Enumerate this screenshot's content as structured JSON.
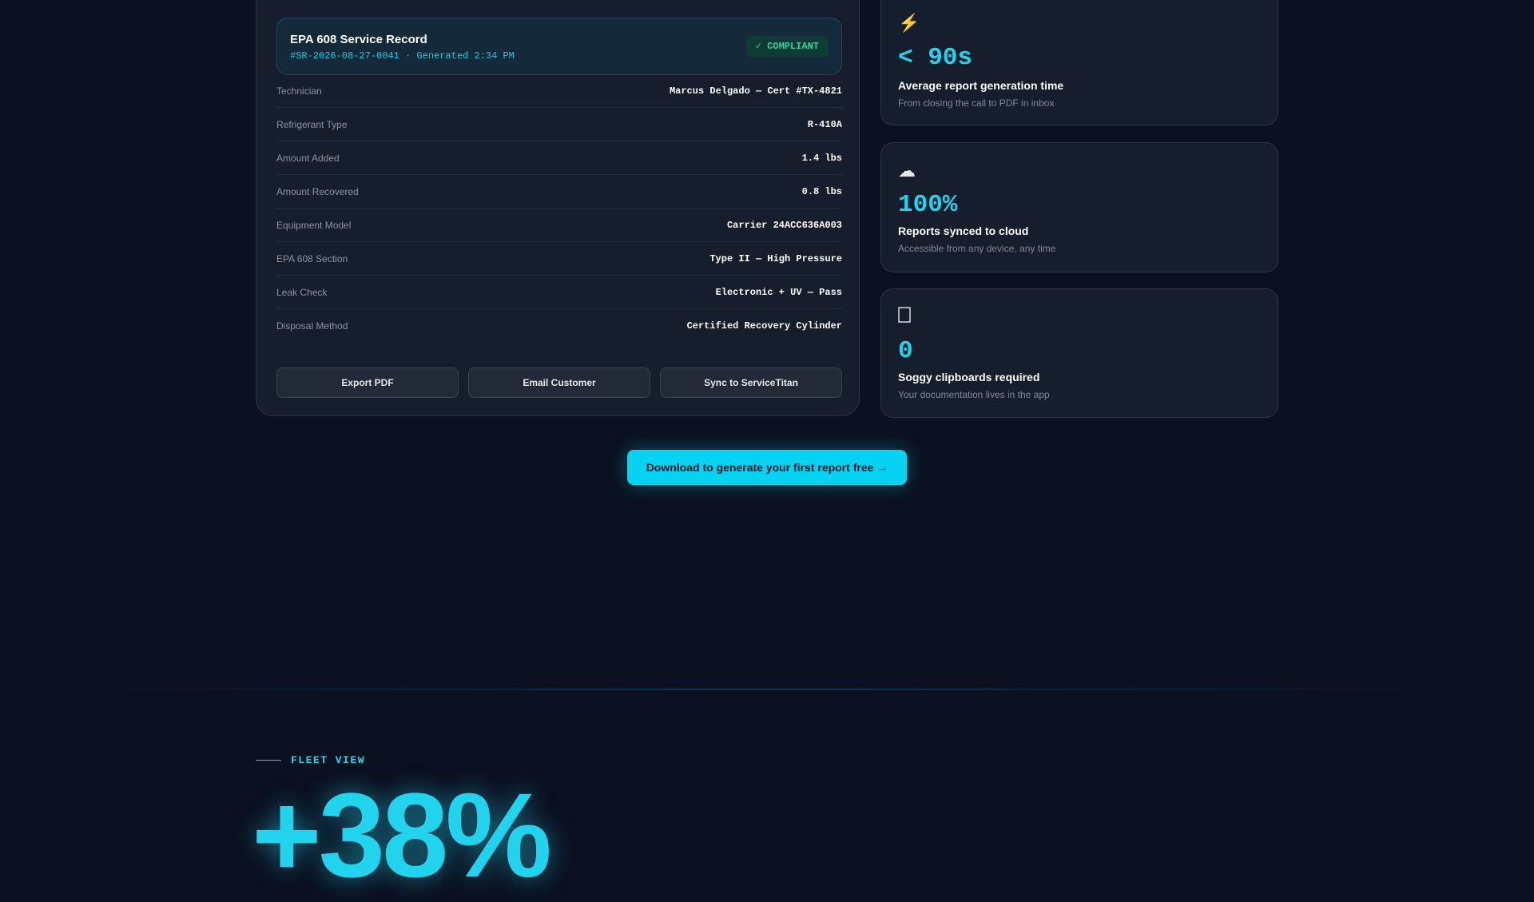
{
  "record": {
    "title": "EPA 608 Service Record",
    "subtitle": "#SR-2026-08-27-0041 · Generated 2:34 PM",
    "badge": "✓ COMPLIANT",
    "rows": [
      {
        "label": "Technician",
        "value": "Marcus Delgado — Cert #TX-4821"
      },
      {
        "label": "Refrigerant Type",
        "value": "R-410A"
      },
      {
        "label": "Amount Added",
        "value": "1.4 lbs"
      },
      {
        "label": "Amount Recovered",
        "value": "0.8 lbs"
      },
      {
        "label": "Equipment Model",
        "value": "Carrier 24ACC636A003"
      },
      {
        "label": "EPA 608 Section",
        "value": "Type II — High Pressure"
      },
      {
        "label": "Leak Check",
        "value": "Electronic + UV — Pass"
      },
      {
        "label": "Disposal Method",
        "value": "Certified Recovery Cylinder"
      }
    ],
    "actions": [
      "Export PDF",
      "Email Customer",
      "Sync to ServiceTitan"
    ]
  },
  "stats": [
    {
      "icon": "⚡",
      "icon_name": "lightning-icon",
      "value": "< 90s",
      "title": "Average report generation time",
      "desc": "From closing the call to PDF in inbox"
    },
    {
      "icon": "☁",
      "icon_name": "cloud-icon",
      "value": "100%",
      "title": "Reports synced to cloud",
      "desc": "Accessible from any device, any time"
    },
    {
      "icon": "📋",
      "icon_name": "clipboard-icon",
      "value": "0",
      "title": "Soggy clipboards required",
      "desc": "Your documentation lives in the app"
    }
  ],
  "cta": {
    "label": "Download to generate your first report free →"
  },
  "fleet": {
    "eyebrow": "FLEET VIEW",
    "big_stat": "+38%"
  },
  "colors": {
    "background": "#0b1120",
    "accent": "#22d3ee",
    "cta": "#06d2f2",
    "compliant": "#34d399"
  }
}
